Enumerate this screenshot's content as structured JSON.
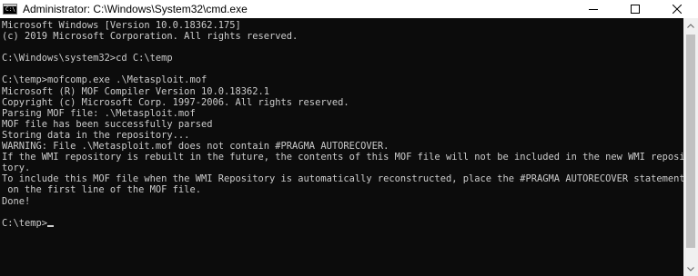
{
  "window": {
    "title": "Administrator: C:\\Windows\\System32\\cmd.exe",
    "icon": "cmd-icon",
    "icon_text": "C:\\"
  },
  "controls": {
    "minimize": "minimize-icon",
    "maximize": "maximize-icon",
    "close": "close-icon"
  },
  "console": {
    "colors": {
      "background": "#0c0c0c",
      "text": "#cccccc"
    },
    "lines": [
      "Microsoft Windows [Version 10.0.18362.175]",
      "(c) 2019 Microsoft Corporation. All rights reserved.",
      "",
      "C:\\Windows\\system32>cd C:\\temp",
      "",
      "C:\\temp>mofcomp.exe .\\Metasploit.mof",
      "Microsoft (R) MOF Compiler Version 10.0.18362.1",
      "Copyright (c) Microsoft Corp. 1997-2006. All rights reserved.",
      "Parsing MOF file: .\\Metasploit.mof",
      "MOF file has been successfully parsed",
      "Storing data in the repository...",
      "WARNING: File .\\Metasploit.mof does not contain #PRAGMA AUTORECOVER.",
      "If the WMI repository is rebuilt in the future, the contents of this MOF file will not be included in the new WMI reposi",
      "tory.",
      "To include this MOF file when the WMI Repository is automatically reconstructed, place the #PRAGMA AUTORECOVER statement",
      " on the first line of the MOF file.",
      "Done!",
      ""
    ],
    "prompt": "C:\\temp>"
  }
}
